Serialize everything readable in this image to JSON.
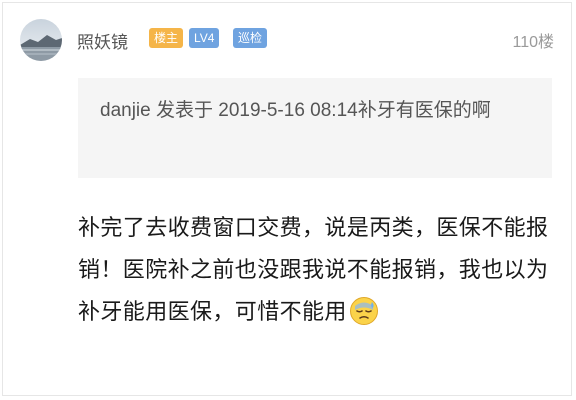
{
  "post": {
    "username": "照妖镜",
    "badges": [
      {
        "label": "楼主",
        "color": "#f5b549"
      },
      {
        "label": "LV4",
        "color": "#6fa3e0"
      },
      {
        "label": "巡检",
        "color": "#6fa3e0"
      }
    ],
    "floor": "110楼",
    "quote": {
      "text": "danjie 发表于 2019-5-16 08:14补牙有医保的啊"
    },
    "content": "补完了去收费窗口交费，说是丙类，医保不能报销！医院补之前也没跟我说不能报销，我也以为补牙能用医保，可惜不能用",
    "emoji": "sweat-face-icon"
  },
  "colors": {
    "quote_bg": "#f5f5f5",
    "text_main": "#1a1a1a",
    "text_muted": "#9a9a9a"
  }
}
